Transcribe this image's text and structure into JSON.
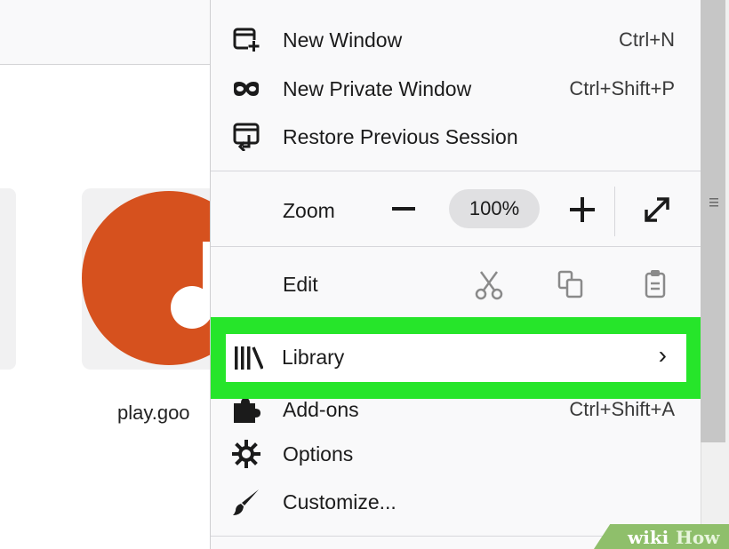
{
  "background": {
    "tile_label": "play.goo",
    "tile_icon": "music-note-icon",
    "tile_color": "#d6511e"
  },
  "menu": {
    "items_top": [
      {
        "label": "New Window",
        "shortcut": "Ctrl+N",
        "icon": "new-window-icon"
      },
      {
        "label": "New Private Window",
        "shortcut": "Ctrl+Shift+P",
        "icon": "private-mask-icon"
      },
      {
        "label": "Restore Previous Session",
        "shortcut": "",
        "icon": "restore-session-icon"
      }
    ],
    "zoom": {
      "label": "Zoom",
      "value": "100%",
      "minus": "−",
      "plus": "+"
    },
    "edit": {
      "label": "Edit"
    },
    "library": {
      "label": "Library",
      "chevron": "›",
      "icon": "library-icon"
    },
    "items_bottom": [
      {
        "label": "Add-ons",
        "shortcut": "Ctrl+Shift+A",
        "icon": "puzzle-icon"
      },
      {
        "label": "Options",
        "shortcut": "",
        "icon": "gear-icon"
      },
      {
        "label": "Customize...",
        "shortcut": "",
        "icon": "paintbrush-icon"
      }
    ]
  },
  "highlight_color": "#26e52a",
  "watermark": {
    "wiki": "wiki",
    "how": "How"
  }
}
